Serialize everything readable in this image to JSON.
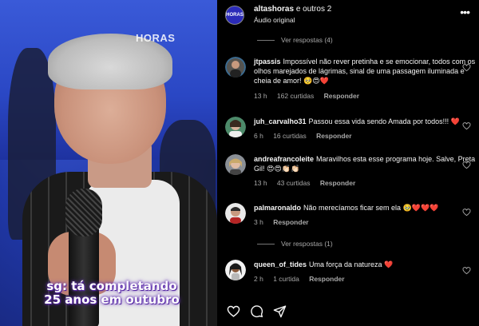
{
  "video": {
    "channel_logo": "HORAS",
    "caption_line1": "sg: tá completando",
    "caption_line2": "25 anos em outubro"
  },
  "header": {
    "owner_name": "altashoras",
    "owner_suffix": "e outros 2",
    "audio": "Áudio original",
    "avatar_text": "HORAS",
    "more_icon": "more-horizontal-icon"
  },
  "top_replies": "Ver respostas (4)",
  "comments": [
    {
      "user": "jtpassis",
      "text": "Impossível não rever pretinha e se emocionar, todos com os olhos marejados de lágrimas, sinal de uma passagem iluminada e cheia de amor!",
      "emoji": "🥺😍❤️",
      "time": "13 h",
      "likes": "162 curtidas",
      "reply": "Responder"
    },
    {
      "user": "juh_carvalho31",
      "text": "Passou essa vida sendo Amada por todos!!!",
      "emoji": "❤️",
      "time": "6 h",
      "likes": "16 curtidas",
      "reply": "Responder"
    },
    {
      "user": "andreafrancoleite",
      "text": "Maravilhos esta esse programa hoje. Salve, Preta Gil!",
      "emoji": "😍😍👏🏻👏🏻",
      "time": "13 h",
      "likes": "43 curtidas",
      "reply": "Responder"
    },
    {
      "user": "palmaronaldo",
      "text": "Não merecíamos ficar sem ela",
      "emoji": "🥹❤️❤️❤️",
      "time": "3 h",
      "likes": "",
      "reply": "Responder"
    },
    {
      "user": "queen_of_tides",
      "text": "Uma força da natureza",
      "emoji": "❤️",
      "time": "2 h",
      "likes": "1 curtida",
      "reply": "Responder"
    }
  ],
  "mid_replies": "Ver respostas (1)",
  "colors": {
    "heart": "#ff3040",
    "background": "#000000",
    "muted": "#a8a8a8"
  }
}
